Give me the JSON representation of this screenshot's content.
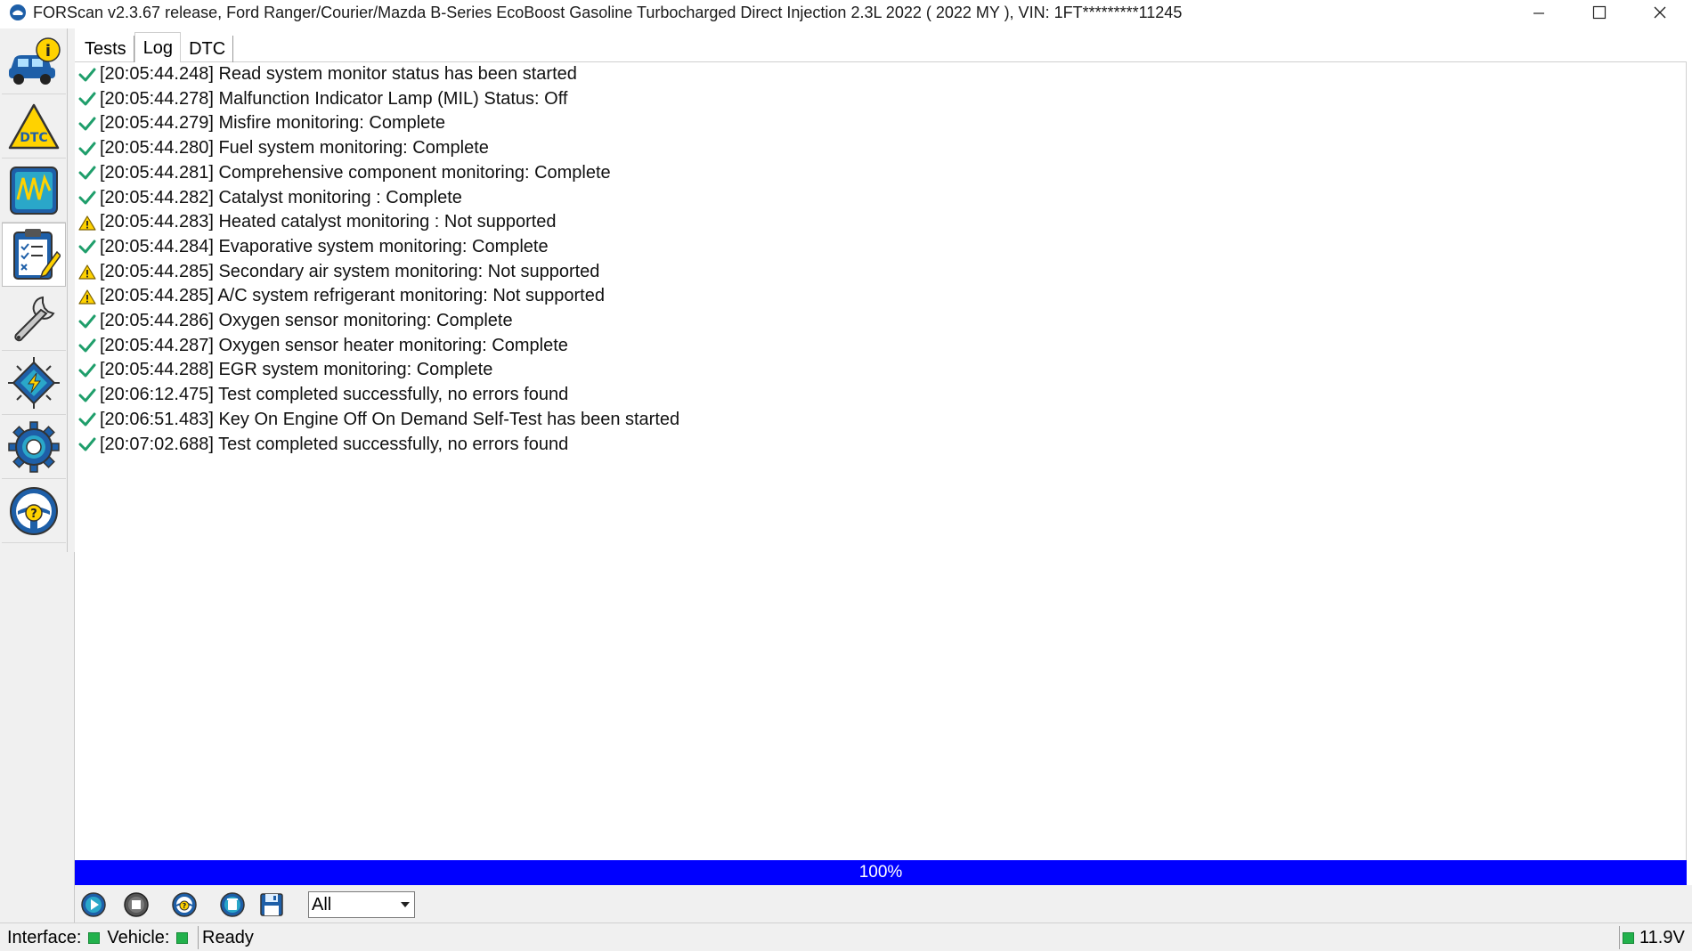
{
  "window": {
    "title": "FORScan v2.3.67 release, Ford Ranger/Courier/Mazda B-Series EcoBoost Gasoline Turbocharged Direct Injection 2.3L 2022 ( 2022 MY ), VIN: 1FT*********11245"
  },
  "sidebar": {
    "items": [
      {
        "name": "vehicle-info",
        "icon": "car-info-icon"
      },
      {
        "name": "dtc",
        "icon": "dtc-warning-icon",
        "label": "DTC"
      },
      {
        "name": "oscilloscope",
        "icon": "oscilloscope-icon"
      },
      {
        "name": "tests",
        "icon": "checklist-icon",
        "active": true
      },
      {
        "name": "service",
        "icon": "wrench-icon"
      },
      {
        "name": "configuration",
        "icon": "chip-icon"
      },
      {
        "name": "settings",
        "icon": "gear-icon"
      },
      {
        "name": "help",
        "icon": "help-wheel-icon"
      }
    ]
  },
  "tabs": [
    {
      "label": "Tests"
    },
    {
      "label": "Log",
      "active": true
    },
    {
      "label": "DTC"
    }
  ],
  "log": [
    {
      "status": "ok",
      "text": "[20:05:44.248] Read system monitor status has been started"
    },
    {
      "status": "ok",
      "text": "[20:05:44.278] Malfunction Indicator Lamp (MIL) Status: Off"
    },
    {
      "status": "ok",
      "text": "[20:05:44.279] Misfire monitoring: Complete"
    },
    {
      "status": "ok",
      "text": "[20:05:44.280] Fuel system monitoring: Complete"
    },
    {
      "status": "ok",
      "text": "[20:05:44.281] Comprehensive component monitoring: Complete"
    },
    {
      "status": "ok",
      "text": "[20:05:44.282] Catalyst monitoring : Complete"
    },
    {
      "status": "warn",
      "text": "[20:05:44.283] Heated catalyst monitoring : Not supported"
    },
    {
      "status": "ok",
      "text": "[20:05:44.284] Evaporative system monitoring: Complete"
    },
    {
      "status": "warn",
      "text": "[20:05:44.285] Secondary air system monitoring: Not supported"
    },
    {
      "status": "warn",
      "text": "[20:05:44.285] A/C system refrigerant monitoring: Not supported"
    },
    {
      "status": "ok",
      "text": "[20:05:44.286] Oxygen sensor monitoring: Complete"
    },
    {
      "status": "ok",
      "text": "[20:05:44.287] Oxygen sensor heater monitoring: Complete"
    },
    {
      "status": "ok",
      "text": "[20:05:44.288] EGR system monitoring: Complete"
    },
    {
      "status": "ok",
      "text": "[20:06:12.475] Test completed successfully, no errors found"
    },
    {
      "status": "ok",
      "text": "[20:06:51.483] Key On Engine Off On Demand Self-Test has been started"
    },
    {
      "status": "ok",
      "text": "[20:07:02.688] Test completed successfully, no errors found"
    }
  ],
  "progress": {
    "value": 1.0,
    "label": "100%",
    "color": "#0000ff"
  },
  "toolbar": {
    "buttons": [
      "play-icon",
      "stop-icon",
      "help-icon",
      "clear-icon",
      "save-icon"
    ],
    "filter_value": "All"
  },
  "status": {
    "interface_label": "Interface:",
    "vehicle_label": "Vehicle:",
    "state": "Ready",
    "voltage": "11.9V",
    "led_color": "#22b14c"
  }
}
